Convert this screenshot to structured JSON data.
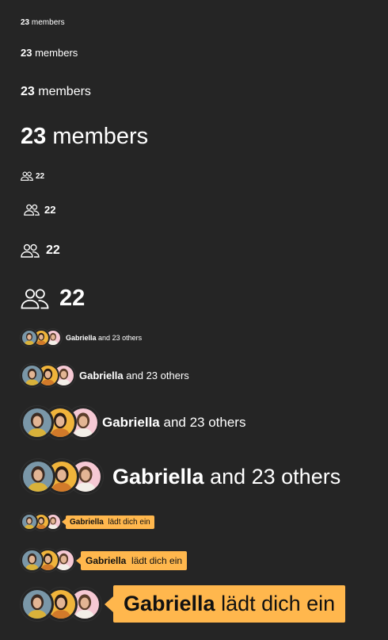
{
  "members": {
    "count": "23",
    "label": "members"
  },
  "participants": {
    "icon": "people-icon",
    "count": "22"
  },
  "avatars": {
    "first_name": "Gabriella",
    "rest_text": "and 23 others",
    "items": [
      "avatar-woman-blue",
      "avatar-woman-yellow",
      "avatar-man-pink"
    ],
    "colors": [
      "#7a97a8",
      "#f0b43b",
      "#f6c9d4"
    ]
  },
  "invite": {
    "first_name": "Gabriella",
    "rest_text": "lädt dich ein",
    "accent": "#ffb74d"
  }
}
